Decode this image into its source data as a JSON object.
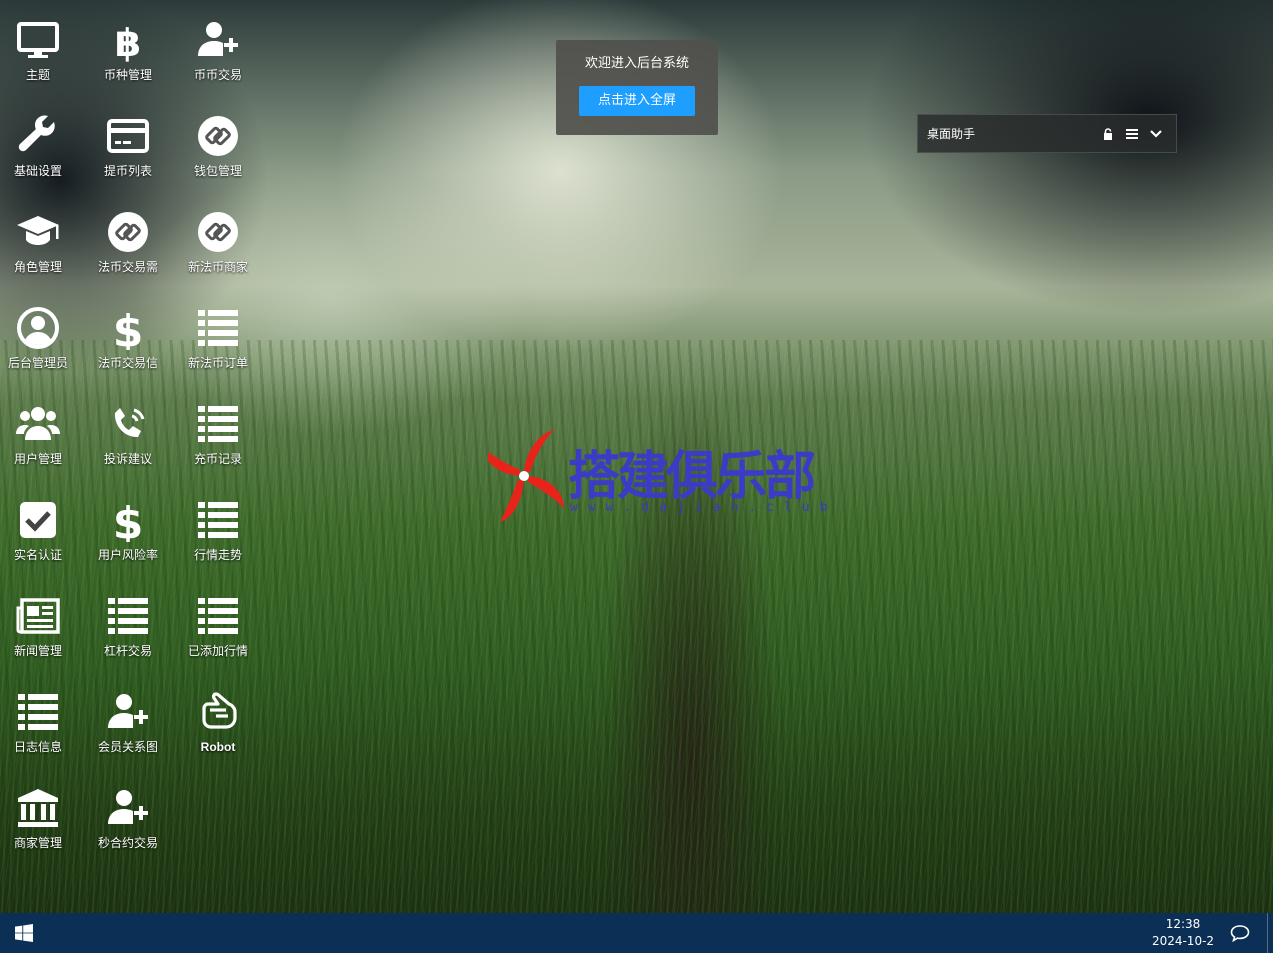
{
  "desktop": {
    "icons": [
      {
        "label": "主题",
        "icon": "monitor-icon"
      },
      {
        "label": "币种管理",
        "icon": "bitcoin-icon"
      },
      {
        "label": "币币交易",
        "icon": "user-plus-icon"
      },
      {
        "label": "基础设置",
        "icon": "wrench-icon"
      },
      {
        "label": "提币列表",
        "icon": "credit-card-icon"
      },
      {
        "label": "钱包管理",
        "icon": "link-circle-icon"
      },
      {
        "label": "角色管理",
        "icon": "graduation-cap-icon"
      },
      {
        "label": "法币交易需",
        "icon": "link-circle-icon"
      },
      {
        "label": "新法币商家",
        "icon": "link-circle-icon"
      },
      {
        "label": "后台管理员",
        "icon": "user-circle-icon"
      },
      {
        "label": "法币交易信",
        "icon": "dollar-icon"
      },
      {
        "label": "新法币订单",
        "icon": "list-icon"
      },
      {
        "label": "用户管理",
        "icon": "users-icon"
      },
      {
        "label": "投诉建议",
        "icon": "phone-volume-icon"
      },
      {
        "label": "充币记录",
        "icon": "list-icon"
      },
      {
        "label": "实名认证",
        "icon": "check-square-icon"
      },
      {
        "label": "用户风险率",
        "icon": "dollar-icon"
      },
      {
        "label": "行情走势",
        "icon": "list-icon"
      },
      {
        "label": "新闻管理",
        "icon": "newspaper-icon"
      },
      {
        "label": "杠杆交易",
        "icon": "list-icon"
      },
      {
        "label": "已添加行情",
        "icon": "list-icon"
      },
      {
        "label": "日志信息",
        "icon": "list-icon"
      },
      {
        "label": "会员关系图",
        "icon": "user-plus-icon"
      },
      {
        "label": "Robot",
        "icon": "hand-peace-icon"
      },
      {
        "label": "商家管理",
        "icon": "bank-icon"
      },
      {
        "label": "秒合约交易",
        "icon": "user-plus-icon"
      }
    ]
  },
  "welcome": {
    "title": "欢迎进入后台系统",
    "button_label": "点击进入全屏"
  },
  "helper": {
    "title": "桌面助手",
    "icons": [
      "lock-icon",
      "menu-icon",
      "chevron-down-icon"
    ]
  },
  "watermark": {
    "text": "搭建俱乐部",
    "subtext": "www.dajian.club"
  },
  "taskbar": {
    "start_icon": "windows-icon",
    "time": "12:38",
    "date": "2024-10-2",
    "notify_icon": "chat-bubble-icon"
  },
  "colors": {
    "taskbar": "#0b2f55",
    "accent_button": "#1e9fff",
    "logo_blue": "#3b3bc8",
    "logo_red": "#e8231a"
  }
}
